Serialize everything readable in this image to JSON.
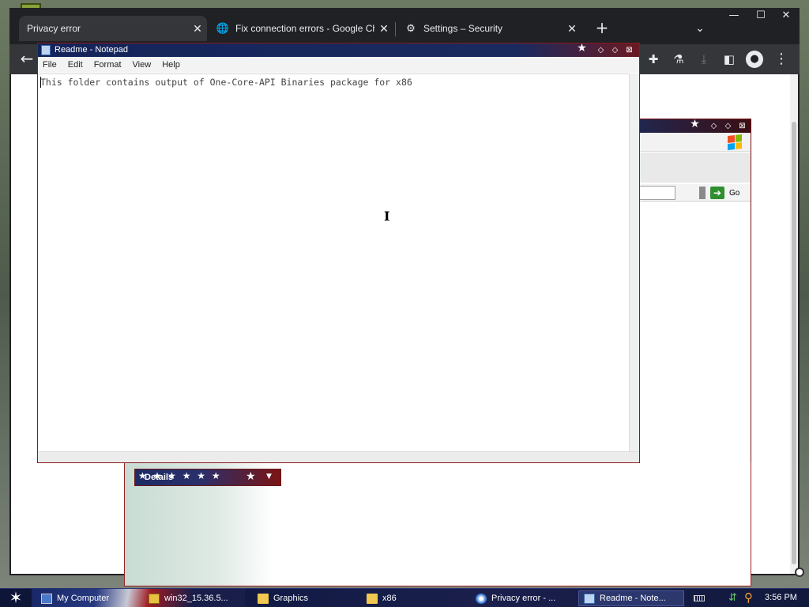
{
  "chrome": {
    "tabs": [
      {
        "title": "Privacy error",
        "active": true
      },
      {
        "title": "Fix connection errors - Google Chrome Help",
        "active": false
      },
      {
        "title": "Settings – Security",
        "active": false
      }
    ],
    "new_tab": "+",
    "tab_search": "⌄",
    "window_controls": {
      "minimize": "—",
      "maximize": "☐",
      "close": "✕"
    },
    "toolbar_icons": [
      "back-arrow-icon",
      "extensions-icon",
      "labs-icon",
      "download-icon",
      "side-panel-icon",
      "profile-icon",
      "menu-icon"
    ]
  },
  "notepad": {
    "title": "Readme - Notepad",
    "menu": [
      "File",
      "Edit",
      "Format",
      "View",
      "Help"
    ],
    "content": "This folder contains output of One-Core-API Binaries package for x86"
  },
  "ie_window": {
    "go_label": "Go"
  },
  "explorer": {
    "details_label": "Details"
  },
  "taskbar": {
    "items": [
      {
        "label": "My Computer"
      },
      {
        "label": "win32_15.36.5..."
      },
      {
        "label": "Graphics"
      },
      {
        "label": "x86"
      },
      {
        "label": "Privacy error - ..."
      },
      {
        "label": "Readme - Note..."
      }
    ],
    "clock": "3:56 PM"
  },
  "colors": {
    "chrome_frame": "#202124",
    "chrome_toolbar": "#35363a",
    "taskbar": "#121b45",
    "titlebar_blue": "#14245a",
    "titlebar_red": "#6a1a22"
  }
}
